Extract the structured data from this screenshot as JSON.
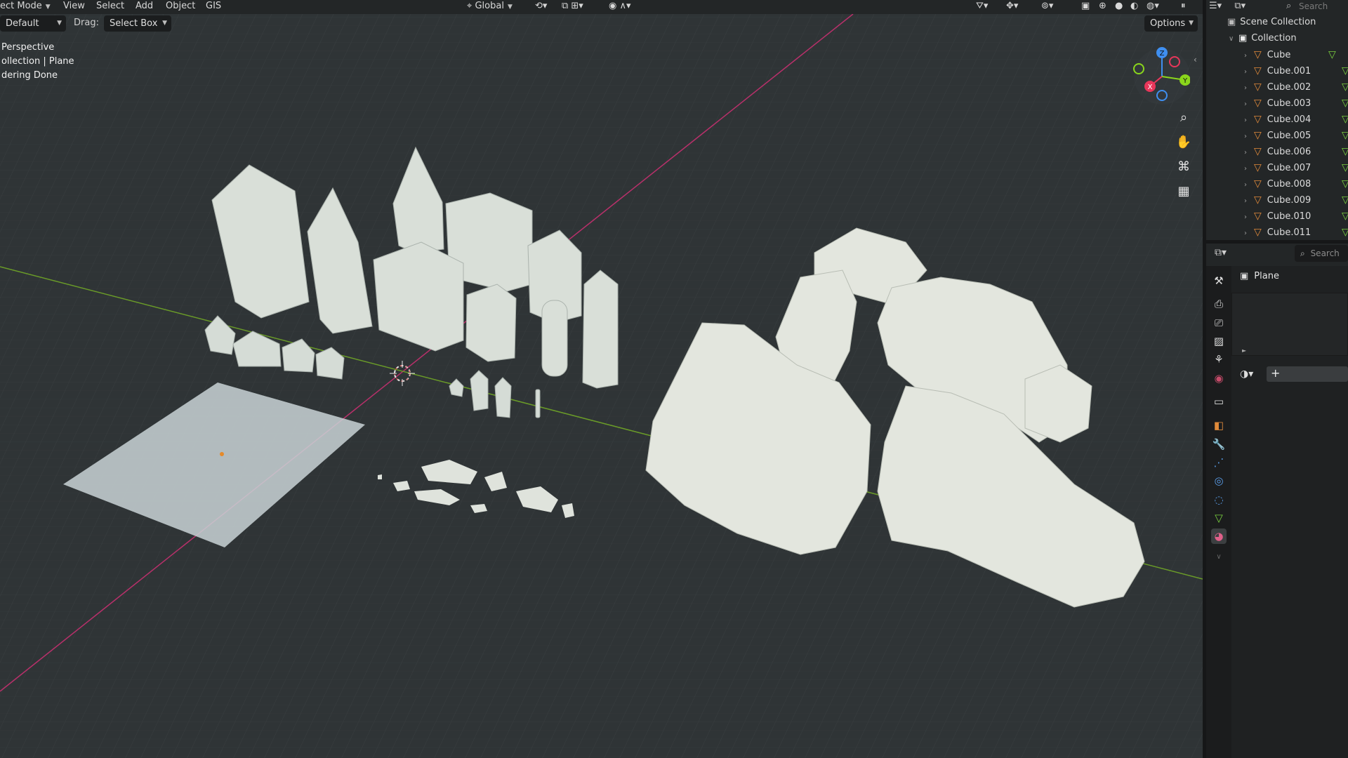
{
  "topbar": {
    "mode": "ect Mode",
    "menus": [
      "View",
      "Select",
      "Add",
      "Object",
      "GIS"
    ],
    "transform": "Global",
    "search_placeholder": "Search"
  },
  "toolbar": {
    "orientation": "Default",
    "drag_label": "Drag:",
    "drag_value": "Select Box",
    "options": "Options"
  },
  "viewport_overlay": {
    "line1": "Perspective",
    "line2": "ollection | Plane",
    "line3": "dering Done"
  },
  "gizmo": {
    "x": "X",
    "y": "Y",
    "z": "Z"
  },
  "outliner": {
    "scene_collection": "Scene Collection",
    "collection": "Collection",
    "items": [
      "Cube",
      "Cube.001",
      "Cube.002",
      "Cube.003",
      "Cube.004",
      "Cube.005",
      "Cube.006",
      "Cube.007",
      "Cube.008",
      "Cube.009",
      "Cube.010",
      "Cube.011"
    ]
  },
  "properties": {
    "search_placeholder": "Search",
    "object_name": "Plane",
    "add_symbol": "+"
  },
  "colors": {
    "x_axis": "#b8306a",
    "y_axis": "#6a9b28",
    "gizmo_x": "#e8365a",
    "gizmo_y": "#8ad61c",
    "gizmo_z": "#3f8ff0",
    "mesh_icon": "#e08a3a",
    "mesh_data_icon": "#7ad13f"
  }
}
